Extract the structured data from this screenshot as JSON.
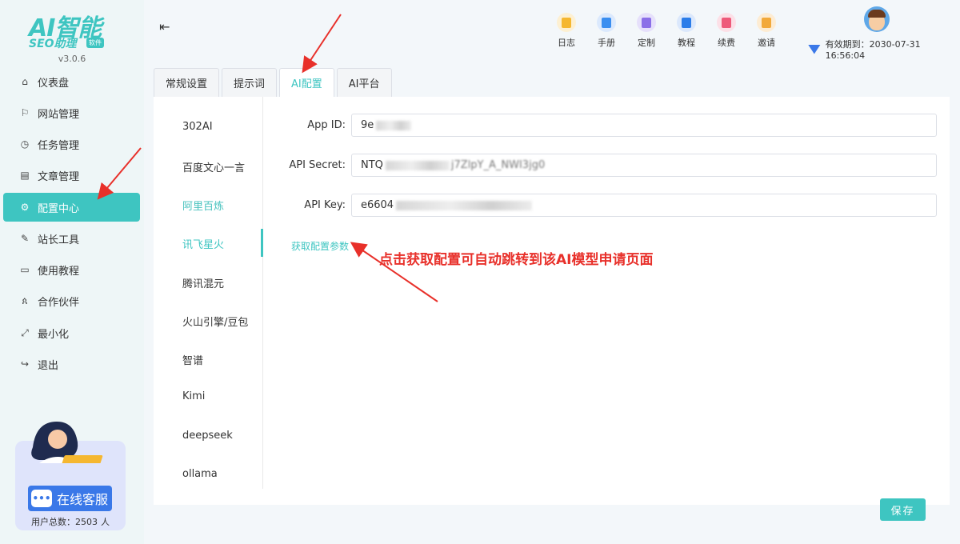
{
  "app": {
    "logo_ai": "AI智能",
    "logo_seo": "SEO助理",
    "logo_badge": "软件",
    "version": "v3.0.6"
  },
  "sidebar": {
    "items": [
      {
        "label": "仪表盘",
        "icon": "home-icon"
      },
      {
        "label": "网站管理",
        "icon": "flag-icon"
      },
      {
        "label": "任务管理",
        "icon": "clock-icon"
      },
      {
        "label": "文章管理",
        "icon": "document-icon"
      },
      {
        "label": "配置中心",
        "icon": "gear-icon",
        "active": true
      },
      {
        "label": "站长工具",
        "icon": "wrench-icon"
      },
      {
        "label": "使用教程",
        "icon": "monitor-icon"
      },
      {
        "label": "合作伙伴",
        "icon": "people-icon"
      },
      {
        "label": "最小化",
        "icon": "minimize-icon"
      },
      {
        "label": "退出",
        "icon": "logout-icon"
      }
    ],
    "support_button": "在线客服",
    "user_count_label": "用户总数：2503",
    "user_count_unit": "人"
  },
  "header": {
    "tools": [
      {
        "label": "日志",
        "icon": "log-icon",
        "color": "#f5b730"
      },
      {
        "label": "手册",
        "icon": "manual-icon",
        "color": "#3a8ef0"
      },
      {
        "label": "定制",
        "icon": "custom-icon",
        "color": "#8b6fe8"
      },
      {
        "label": "教程",
        "icon": "tutorial-icon",
        "color": "#2b7de9"
      },
      {
        "label": "续费",
        "icon": "renew-icon",
        "color": "#ee5a7a"
      },
      {
        "label": "邀请",
        "icon": "invite-icon",
        "color": "#f2a93b"
      }
    ],
    "expiry_text": "有效期到：2030-07-31 16:56:04"
  },
  "tabs": [
    "常规设置",
    "提示词",
    "AI配置",
    "AI平台"
  ],
  "providers": [
    "302AI",
    "百度文心一言",
    "阿里百炼",
    "讯飞星火",
    "腾讯混元",
    "火山引擎/豆包",
    "智谱",
    "Kimi",
    "deepseek",
    "ollama"
  ],
  "form": {
    "app_id_label": "App ID:",
    "app_id_value": "9e",
    "api_secret_label": "API Secret:",
    "api_secret_value": "NTQ",
    "api_secret_tail": "j7ZlpY_A_NWI3jg0",
    "api_key_label": "API Key:",
    "api_key_value": "e6604",
    "get_config_link": "获取配置参数"
  },
  "annotation": "点击获取配置可自动跳转到该AI模型申请页面",
  "save_button": "保存",
  "colors": {
    "accent": "#3ec5c1",
    "annotation": "#e8302a"
  }
}
